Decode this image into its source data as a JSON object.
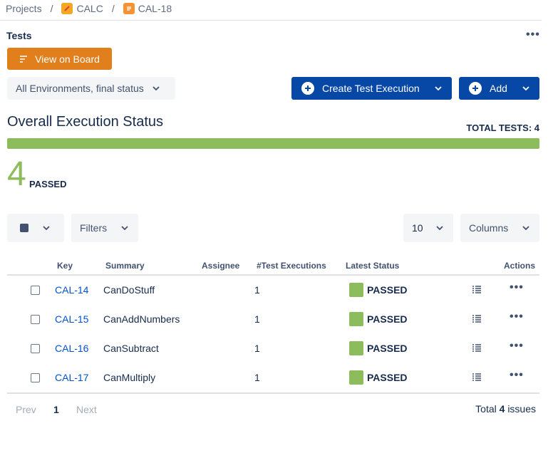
{
  "breadcrumb": {
    "projects": "Projects",
    "separator": "/",
    "project": "CALC",
    "issue": "CAL-18"
  },
  "section": {
    "title": "Tests",
    "more": "•••"
  },
  "toolbar": {
    "view_on_board": "View on Board",
    "environment_filter": "All Environments, final status",
    "create_test_execution": "Create Test Execution",
    "add": "Add"
  },
  "overall": {
    "title": "Overall Execution Status",
    "total_tests_label": "TOTAL TESTS: 4",
    "passed_fraction": 1.0,
    "passed_count": "4",
    "passed_label": "PASSED",
    "pass_color": "#8cbc5b"
  },
  "controls": {
    "filters": "Filters",
    "page_size": "10",
    "columns": "Columns"
  },
  "table": {
    "headers": {
      "key": "Key",
      "summary": "Summary",
      "assignee": "Assignee",
      "test_executions": "#Test Executions",
      "latest_status": "Latest Status",
      "actions": "Actions"
    },
    "rows": [
      {
        "key": "CAL-14",
        "summary": "CanDoStuff",
        "assignee": "",
        "executions": "1",
        "status": "PASSED"
      },
      {
        "key": "CAL-15",
        "summary": "CanAddNumbers",
        "assignee": "",
        "executions": "1",
        "status": "PASSED"
      },
      {
        "key": "CAL-16",
        "summary": "CanSubtract",
        "assignee": "",
        "executions": "1",
        "status": "PASSED"
      },
      {
        "key": "CAL-17",
        "summary": "CanMultiply",
        "assignee": "",
        "executions": "1",
        "status": "PASSED"
      }
    ],
    "row_more": "•••"
  },
  "pagination": {
    "prev": "Prev",
    "current": "1",
    "next": "Next",
    "total_prefix": "Total",
    "total_count": "4",
    "total_suffix": "issues"
  },
  "colors": {
    "brand_blue": "#0747a6",
    "board_orange": "#e07f1c",
    "link_blue": "#0052cc"
  }
}
